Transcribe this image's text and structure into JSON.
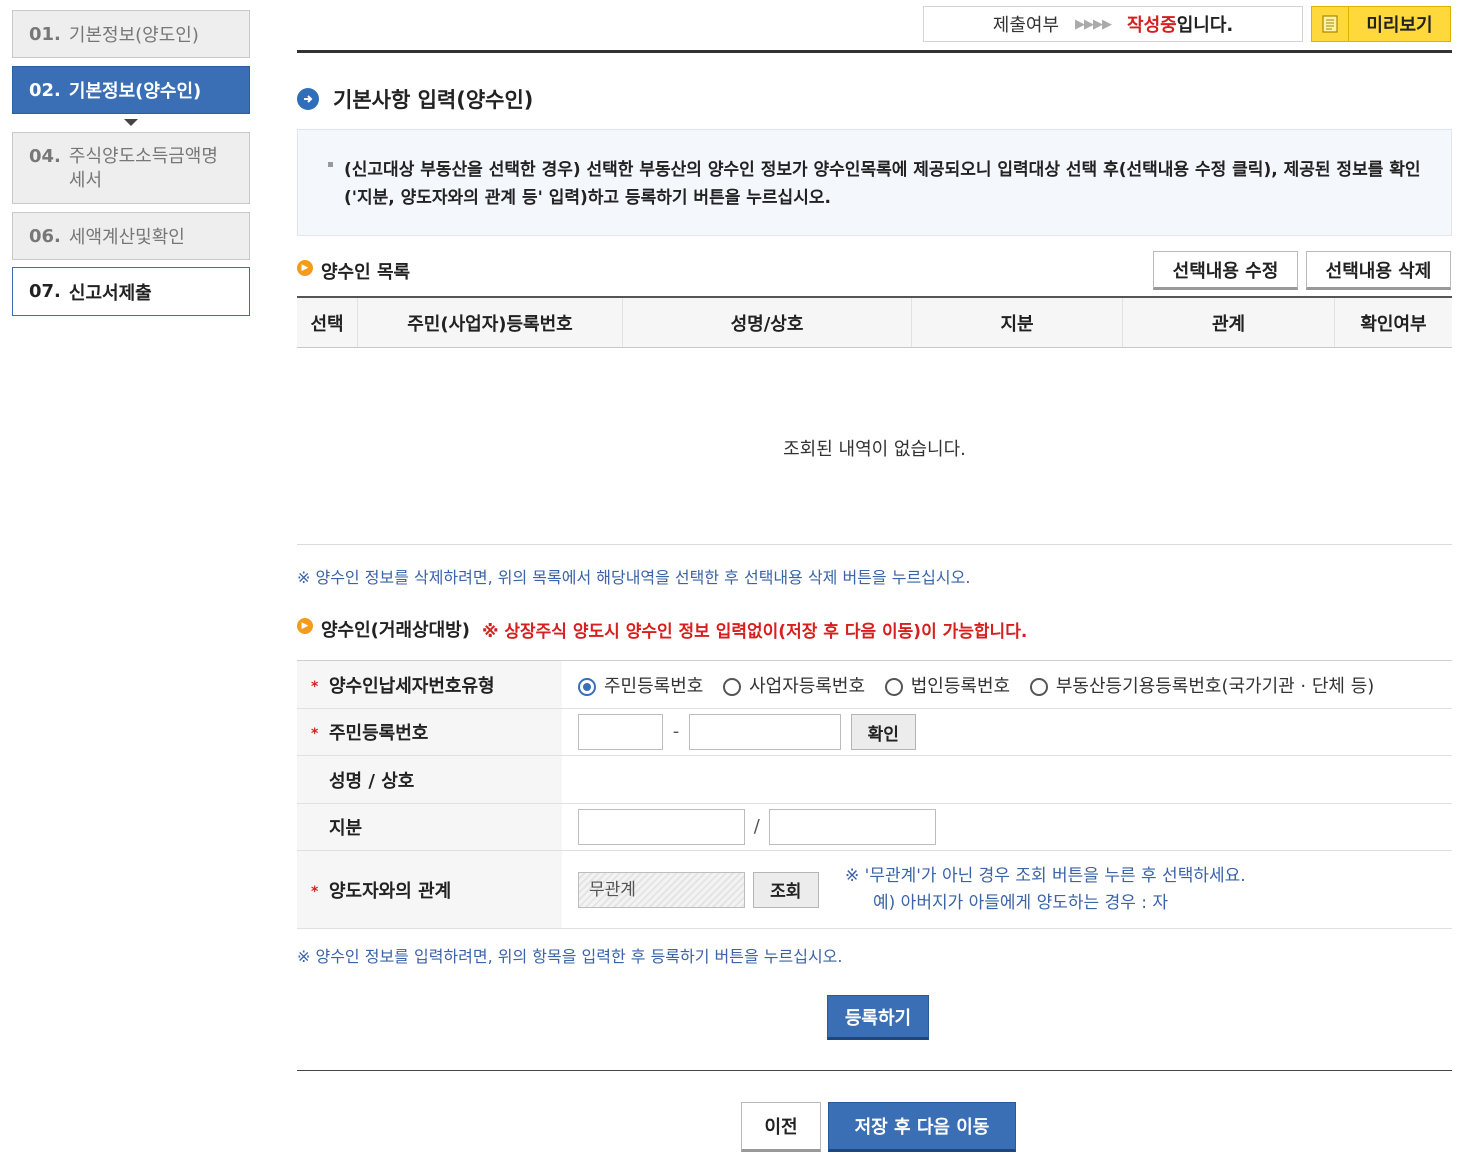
{
  "sidebar": {
    "steps": [
      {
        "num": "01.",
        "label": "기본정보(양도인)"
      },
      {
        "num": "02.",
        "label": "기본정보(양수인)"
      },
      {
        "num": "04.",
        "label": "주식양도소득금액명세서"
      },
      {
        "num": "06.",
        "label": "세액계산및확인"
      },
      {
        "num": "07.",
        "label": "신고서제출"
      }
    ]
  },
  "header": {
    "status_label": "제출여부",
    "status_arrows": "▶▶▶▶",
    "status_value": "작성중",
    "status_suffix": "입니다.",
    "preview_button": "미리보기"
  },
  "section": {
    "title": "기본사항 입력(양수인)",
    "info_text": "(신고대상 부동산을 선택한 경우) 선택한 부동산의 양수인 정보가 양수인목록에 제공되오니 입력대상 선택 후(선택내용 수정 클릭), 제공된 정보를 확인('지분, 양도자와의 관계 등' 입력)하고 등록하기 버튼을 누르십시오."
  },
  "list": {
    "title": "양수인 목록",
    "edit_button": "선택내용 수정",
    "delete_button": "선택내용 삭제",
    "columns": [
      "선택",
      "주민(사업자)등록번호",
      "성명/상호",
      "지분",
      "관계",
      "확인여부"
    ],
    "empty_message": "조회된 내역이 없습니다.",
    "delete_note": "※ 양수인 정보를 삭제하려면, 위의 목록에서 해당내역을 선택한 후 선택내용 삭제 버튼을 누르십시오."
  },
  "form": {
    "title": "양수인(거래상대방)",
    "title_notice": "※ 상장주식 양도시 양수인 정보 입력없이(저장 후 다음 이동)이 가능합니다.",
    "required_mark": "*",
    "labels": {
      "taxpayer_type": "양수인납세자번호유형",
      "resident_number": "주민등록번호",
      "name": "성명 / 상호",
      "share": "지분",
      "relation": "양도자와의 관계"
    },
    "taxpayer_type_options": [
      "주민등록번호",
      "사업자등록번호",
      "법인등록번호",
      "부동산등기용등록번호(국가기관 · 단체 등)"
    ],
    "taxpayer_type_selected": "주민등록번호",
    "resident_separator": "-",
    "confirm_button": "확인",
    "share_separator": "/",
    "relation_value": "무관계",
    "lookup_button": "조회",
    "relation_note_1": "※ '무관계'가 아닌 경우 조회 버튼을 누른 후 선택하세요.",
    "relation_note_2": "예) 아버지가 아들에게 양도하는 경우 : 자",
    "input_note": "※ 양수인 정보를 입력하려면, 위의 항목을 입력한 후 등록하기 버튼을 누르십시오.",
    "register_button": "등록하기"
  },
  "footer": {
    "prev_button": "이전",
    "next_button": "저장 후 다음 이동"
  },
  "colors": {
    "accent_blue": "#3a6eb5",
    "alert_red": "#d81e1e",
    "note_blue": "#3a63a8",
    "preview_yellow": "#ffd83c"
  }
}
